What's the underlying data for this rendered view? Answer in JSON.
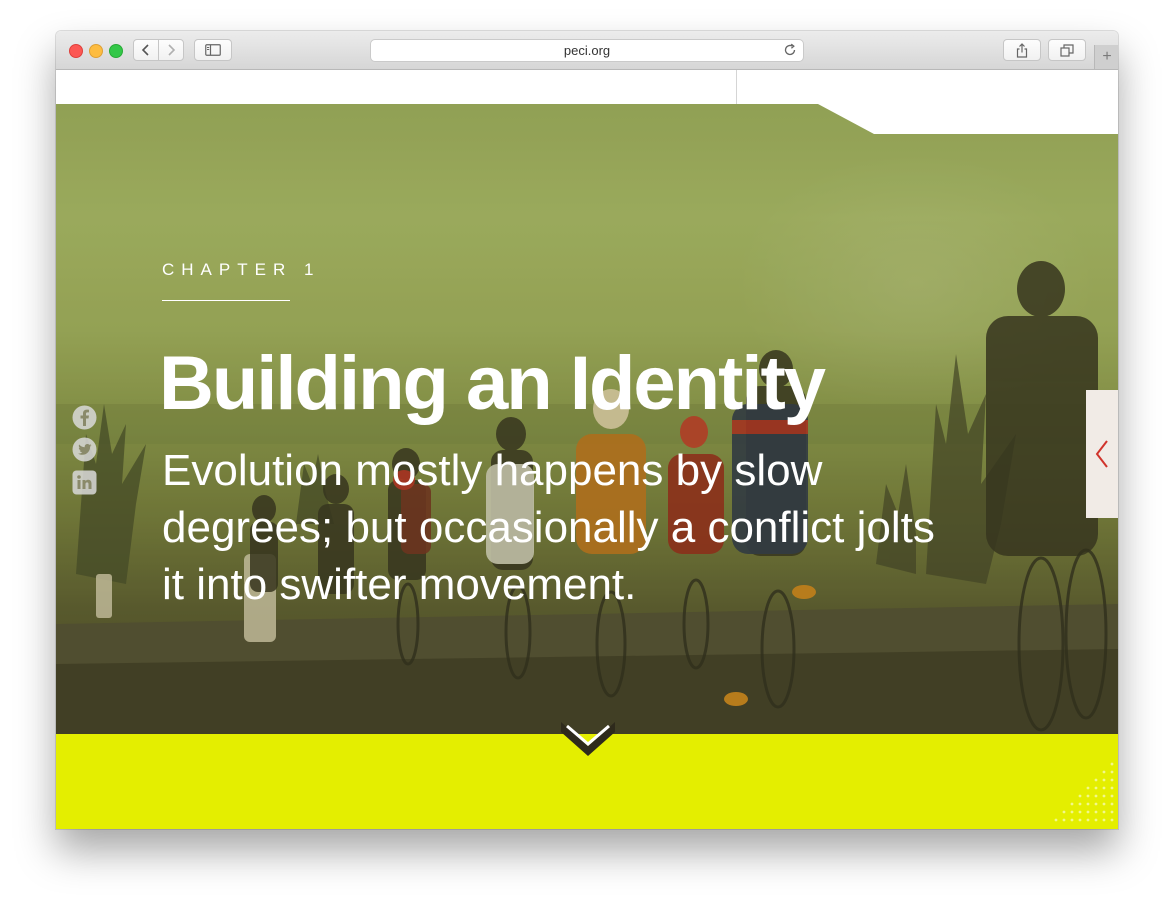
{
  "browser": {
    "url": "peci.org",
    "new_tab_label": "+"
  },
  "hero": {
    "chapter_label": "CHAPTER 1",
    "title": "Building an Identity",
    "subtitle": "Evolution mostly happens by slow degrees; but occasionally a conflict jolts it into swifter movement."
  },
  "social": [
    {
      "name": "facebook",
      "icon": "facebook-icon"
    },
    {
      "name": "twitter",
      "icon": "twitter-icon"
    },
    {
      "name": "linkedin",
      "icon": "linkedin-icon"
    }
  ],
  "colors": {
    "accent_yellow": "#e4ee00",
    "next_arrow": "#d0342c",
    "hero_tint": "#9fae62"
  }
}
